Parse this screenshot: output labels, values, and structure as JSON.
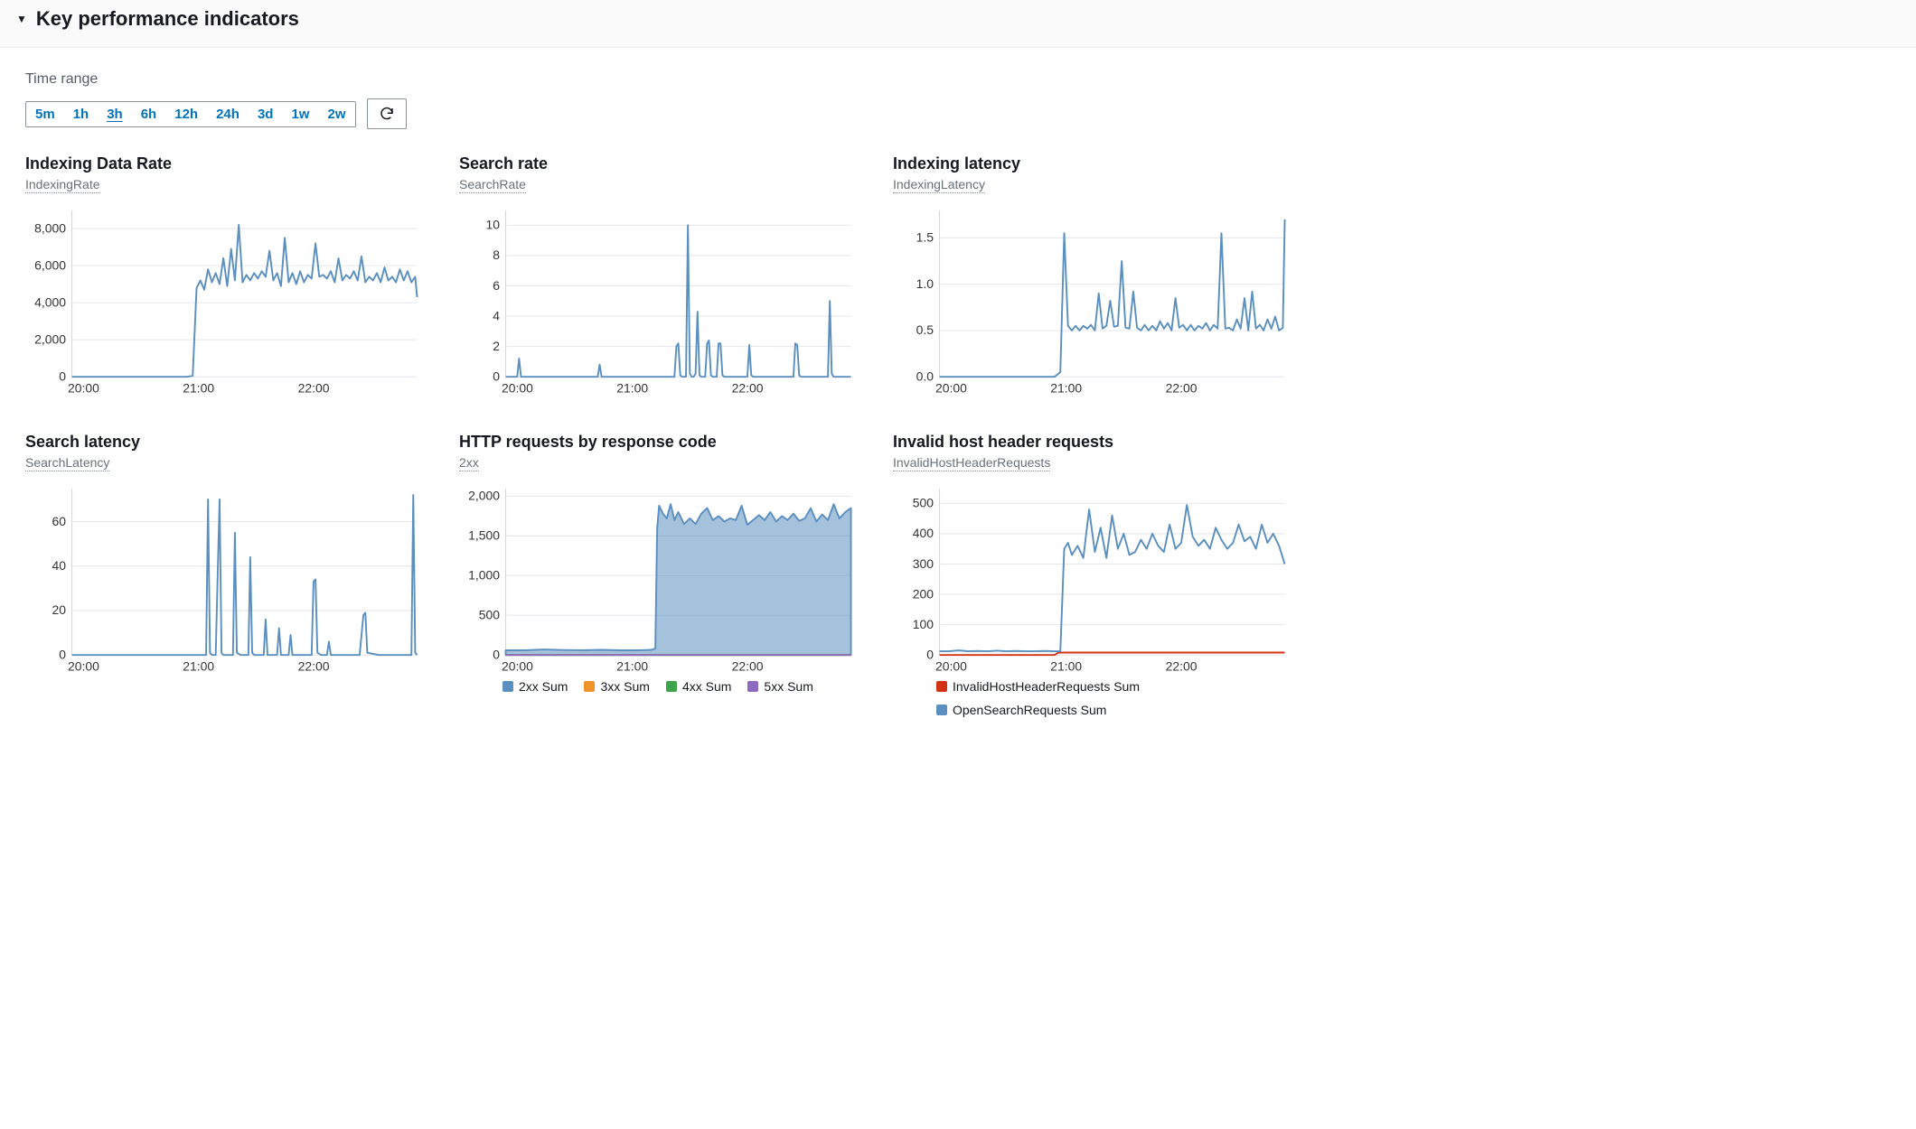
{
  "header": {
    "title": "Key performance indicators",
    "toggle_glyph": "▼"
  },
  "time_range": {
    "label": "Time range",
    "options": [
      "5m",
      "1h",
      "3h",
      "6h",
      "12h",
      "24h",
      "3d",
      "1w",
      "2w"
    ],
    "selected": "3h"
  },
  "icons": {
    "refresh": "refresh-icon"
  },
  "colors": {
    "blue": "#5b8fbf",
    "blue2": "#5b8fbf",
    "orange": "#f0932b",
    "green": "#3fa34d",
    "purple": "#8e6bbf",
    "red": "#d13212"
  },
  "x_ticks": [
    "20:00",
    "21:00",
    "22:00"
  ],
  "chart_data": [
    {
      "id": "indexing-rate",
      "title": "Indexing Data Rate",
      "subtitle": "IndexingRate",
      "type": "line",
      "xlabel": "",
      "ylabel": "",
      "x_range": [
        0,
        180
      ],
      "y_ticks": [
        0,
        2000,
        4000,
        6000,
        8000
      ],
      "y_tick_labels": [
        "0",
        "2,000",
        "4,000",
        "6,000",
        "8,000"
      ],
      "ylim": [
        0,
        9000
      ],
      "series": [
        {
          "name": "IndexingRate",
          "color": "blue",
          "x": [
            0,
            5,
            10,
            15,
            20,
            25,
            30,
            35,
            40,
            45,
            50,
            55,
            60,
            63,
            65,
            67,
            69,
            71,
            73,
            75,
            77,
            79,
            81,
            83,
            85,
            87,
            89,
            91,
            93,
            95,
            97,
            99,
            101,
            103,
            105,
            107,
            109,
            111,
            113,
            115,
            117,
            119,
            121,
            123,
            125,
            127,
            129,
            131,
            133,
            135,
            137,
            139,
            141,
            143,
            145,
            147,
            149,
            151,
            153,
            155,
            157,
            159,
            161,
            163,
            165,
            167,
            169,
            171,
            173,
            175,
            177,
            179,
            180
          ],
          "y": [
            0,
            0,
            0,
            0,
            0,
            0,
            0,
            0,
            0,
            0,
            0,
            0,
            0,
            50,
            4800,
            5200,
            4700,
            5800,
            5100,
            5600,
            5000,
            6400,
            4900,
            6900,
            5200,
            8200,
            5100,
            5500,
            5200,
            5600,
            5300,
            5700,
            5400,
            6800,
            5200,
            5600,
            4900,
            7500,
            5100,
            5600,
            5000,
            5700,
            5100,
            5500,
            5300,
            7200,
            5400,
            5500,
            5300,
            5700,
            5100,
            6400,
            5200,
            5500,
            5300,
            5700,
            5200,
            6500,
            5100,
            5400,
            5200,
            5600,
            5100,
            5900,
            5200,
            5400,
            5100,
            5800,
            5200,
            5700,
            5100,
            5400,
            4300
          ]
        }
      ]
    },
    {
      "id": "search-rate",
      "title": "Search rate",
      "subtitle": "SearchRate",
      "type": "line",
      "x_range": [
        0,
        180
      ],
      "y_ticks": [
        0,
        2,
        4,
        6,
        8,
        10
      ],
      "y_tick_labels": [
        "0",
        "2",
        "4",
        "6",
        "8",
        "10"
      ],
      "ylim": [
        0,
        11
      ],
      "series": [
        {
          "name": "SearchRate",
          "color": "blue",
          "x": [
            0,
            6,
            7,
            8,
            9,
            10,
            20,
            30,
            40,
            48,
            49,
            50,
            51,
            60,
            70,
            80,
            88,
            89,
            90,
            91,
            92,
            94,
            95,
            96,
            97,
            98,
            99,
            100,
            101,
            102,
            104,
            105,
            106,
            107,
            108,
            110,
            111,
            112,
            113,
            114,
            116,
            120,
            126,
            127,
            128,
            129,
            130,
            135,
            140,
            145,
            150,
            151,
            152,
            153,
            154,
            160,
            165,
            168,
            169,
            170,
            171,
            172,
            175,
            180
          ],
          "y": [
            0,
            0,
            1.2,
            0,
            0,
            0,
            0,
            0,
            0,
            0,
            0.8,
            0,
            0,
            0,
            0,
            0,
            0,
            2.0,
            2.2,
            0.1,
            0,
            0,
            10.0,
            0.2,
            0,
            0,
            0.2,
            4.3,
            0.1,
            0,
            0,
            2.2,
            2.4,
            0.1,
            0,
            0,
            2.2,
            2.2,
            0.1,
            0,
            0,
            0,
            0,
            2.1,
            0.1,
            0,
            0,
            0,
            0,
            0,
            0,
            2.2,
            2.1,
            0.1,
            0,
            0,
            0,
            0,
            5.0,
            0.2,
            0,
            0,
            0,
            0
          ]
        }
      ]
    },
    {
      "id": "indexing-latency",
      "title": "Indexing latency",
      "subtitle": "IndexingLatency",
      "type": "line",
      "x_range": [
        0,
        180
      ],
      "y_ticks": [
        0,
        0.5,
        1.0,
        1.5
      ],
      "y_tick_labels": [
        "0.0",
        "0.5",
        "1.0",
        "1.5"
      ],
      "ylim": [
        0,
        1.8
      ],
      "series": [
        {
          "name": "IndexingLatency",
          "color": "blue",
          "x": [
            0,
            5,
            10,
            15,
            20,
            25,
            30,
            35,
            40,
            45,
            50,
            55,
            60,
            63,
            65,
            67,
            69,
            71,
            73,
            75,
            77,
            79,
            81,
            83,
            85,
            87,
            89,
            91,
            93,
            95,
            97,
            99,
            101,
            103,
            105,
            107,
            109,
            111,
            113,
            115,
            117,
            119,
            121,
            123,
            125,
            127,
            129,
            131,
            133,
            135,
            137,
            139,
            141,
            143,
            145,
            147,
            149,
            151,
            153,
            155,
            157,
            159,
            161,
            163,
            165,
            167,
            169,
            171,
            173,
            175,
            177,
            179,
            180
          ],
          "y": [
            0,
            0,
            0,
            0,
            0,
            0,
            0,
            0,
            0,
            0,
            0,
            0,
            0,
            0.05,
            1.55,
            0.55,
            0.5,
            0.55,
            0.5,
            0.55,
            0.52,
            0.56,
            0.5,
            0.9,
            0.52,
            0.55,
            0.82,
            0.54,
            0.55,
            1.25,
            0.53,
            0.52,
            0.92,
            0.53,
            0.5,
            0.56,
            0.5,
            0.55,
            0.5,
            0.6,
            0.52,
            0.58,
            0.5,
            0.85,
            0.53,
            0.56,
            0.5,
            0.56,
            0.5,
            0.55,
            0.52,
            0.58,
            0.5,
            0.56,
            0.52,
            1.55,
            0.52,
            0.53,
            0.5,
            0.62,
            0.52,
            0.85,
            0.5,
            0.92,
            0.52,
            0.56,
            0.5,
            0.62,
            0.52,
            0.65,
            0.5,
            0.53,
            1.7
          ]
        }
      ]
    },
    {
      "id": "search-latency",
      "title": "Search latency",
      "subtitle": "SearchLatency",
      "type": "line",
      "x_range": [
        0,
        180
      ],
      "y_ticks": [
        0,
        20,
        40,
        60
      ],
      "y_tick_labels": [
        "0",
        "20",
        "40",
        "60"
      ],
      "ylim": [
        0,
        75
      ],
      "series": [
        {
          "name": "SearchLatency",
          "color": "blue",
          "x": [
            0,
            20,
            40,
            60,
            70,
            71,
            72,
            73,
            75,
            77,
            78,
            79,
            80,
            84,
            85,
            86,
            88,
            92,
            93,
            94,
            95,
            96,
            100,
            101,
            102,
            107,
            108,
            109,
            113,
            114,
            115,
            125,
            126,
            127,
            128,
            130,
            133,
            134,
            135,
            140,
            145,
            150,
            152,
            153,
            154,
            160,
            165,
            170,
            175,
            177,
            178,
            179,
            180
          ],
          "y": [
            0,
            0,
            0,
            0,
            0,
            70,
            1,
            0,
            0,
            70,
            1,
            0,
            0,
            0,
            55,
            1,
            0,
            0,
            44,
            1,
            0,
            0,
            0,
            16,
            0,
            0,
            12,
            0,
            0,
            9,
            0,
            0,
            33,
            34,
            1,
            0,
            0,
            6,
            0,
            0,
            0,
            0,
            18,
            19,
            1,
            0,
            0,
            0,
            0,
            0,
            72,
            1,
            0
          ]
        }
      ]
    },
    {
      "id": "http-requests",
      "title": "HTTP requests by response code",
      "subtitle": "2xx",
      "type": "area",
      "x_range": [
        0,
        180
      ],
      "y_ticks": [
        0,
        500,
        1000,
        1500,
        2000
      ],
      "y_tick_labels": [
        "0",
        "500",
        "1,000",
        "1,500",
        "2,000"
      ],
      "ylim": [
        0,
        2100
      ],
      "legend": [
        {
          "label": "2xx Sum",
          "color": "blue"
        },
        {
          "label": "3xx Sum",
          "color": "orange"
        },
        {
          "label": "4xx Sum",
          "color": "green"
        },
        {
          "label": "5xx Sum",
          "color": "purple"
        }
      ],
      "series": [
        {
          "name": "2xx Sum",
          "color": "blue",
          "fill": true,
          "x": [
            0,
            10,
            20,
            30,
            40,
            50,
            60,
            70,
            76,
            78,
            79,
            80,
            82,
            84,
            86,
            88,
            90,
            93,
            96,
            99,
            102,
            105,
            108,
            111,
            114,
            117,
            120,
            123,
            126,
            129,
            132,
            135,
            138,
            141,
            144,
            147,
            150,
            153,
            156,
            159,
            162,
            165,
            168,
            171,
            174,
            177,
            180
          ],
          "y": [
            60,
            58,
            70,
            62,
            60,
            65,
            58,
            60,
            65,
            80,
            1600,
            1880,
            1780,
            1720,
            1900,
            1700,
            1800,
            1650,
            1720,
            1650,
            1780,
            1850,
            1700,
            1750,
            1680,
            1720,
            1700,
            1880,
            1640,
            1700,
            1760,
            1700,
            1800,
            1680,
            1750,
            1700,
            1780,
            1690,
            1720,
            1850,
            1680,
            1770,
            1700,
            1900,
            1720,
            1800,
            1850
          ]
        },
        {
          "name": "3xx Sum",
          "color": "orange",
          "x": [
            0,
            180
          ],
          "y": [
            0,
            0
          ]
        },
        {
          "name": "4xx Sum",
          "color": "green",
          "x": [
            0,
            180
          ],
          "y": [
            0,
            0
          ]
        },
        {
          "name": "5xx Sum",
          "color": "purple",
          "x": [
            0,
            180
          ],
          "y": [
            0,
            0
          ]
        }
      ]
    },
    {
      "id": "invalid-host",
      "title": "Invalid host header requests",
      "subtitle": "InvalidHostHeaderRequests",
      "type": "line",
      "x_range": [
        0,
        180
      ],
      "y_ticks": [
        0,
        100,
        200,
        300,
        400,
        500
      ],
      "y_tick_labels": [
        "0",
        "100",
        "200",
        "300",
        "400",
        "500"
      ],
      "ylim": [
        0,
        550
      ],
      "legend": [
        {
          "label": "InvalidHostHeaderRequests Sum",
          "color": "red"
        },
        {
          "label": "OpenSearchRequests Sum",
          "color": "blue"
        }
      ],
      "series": [
        {
          "name": "InvalidHostHeaderRequests Sum",
          "color": "red",
          "x": [
            0,
            60,
            62,
            180
          ],
          "y": [
            0,
            0,
            8,
            8
          ]
        },
        {
          "name": "OpenSearchRequests Sum",
          "color": "blue",
          "x": [
            0,
            5,
            10,
            15,
            20,
            25,
            30,
            35,
            40,
            45,
            50,
            55,
            60,
            63,
            65,
            67,
            69,
            72,
            75,
            78,
            81,
            84,
            87,
            90,
            93,
            96,
            99,
            102,
            105,
            108,
            111,
            114,
            117,
            120,
            123,
            126,
            129,
            132,
            135,
            138,
            141,
            144,
            147,
            150,
            153,
            156,
            159,
            162,
            165,
            168,
            171,
            174,
            177,
            180
          ],
          "y": [
            12,
            12,
            15,
            12,
            13,
            12,
            14,
            12,
            13,
            12,
            12,
            13,
            12,
            12,
            350,
            370,
            330,
            360,
            320,
            480,
            340,
            420,
            320,
            460,
            350,
            400,
            330,
            340,
            380,
            350,
            400,
            360,
            340,
            430,
            350,
            370,
            495,
            390,
            360,
            380,
            350,
            420,
            380,
            350,
            370,
            430,
            375,
            390,
            350,
            430,
            370,
            400,
            360,
            300
          ]
        }
      ]
    }
  ]
}
